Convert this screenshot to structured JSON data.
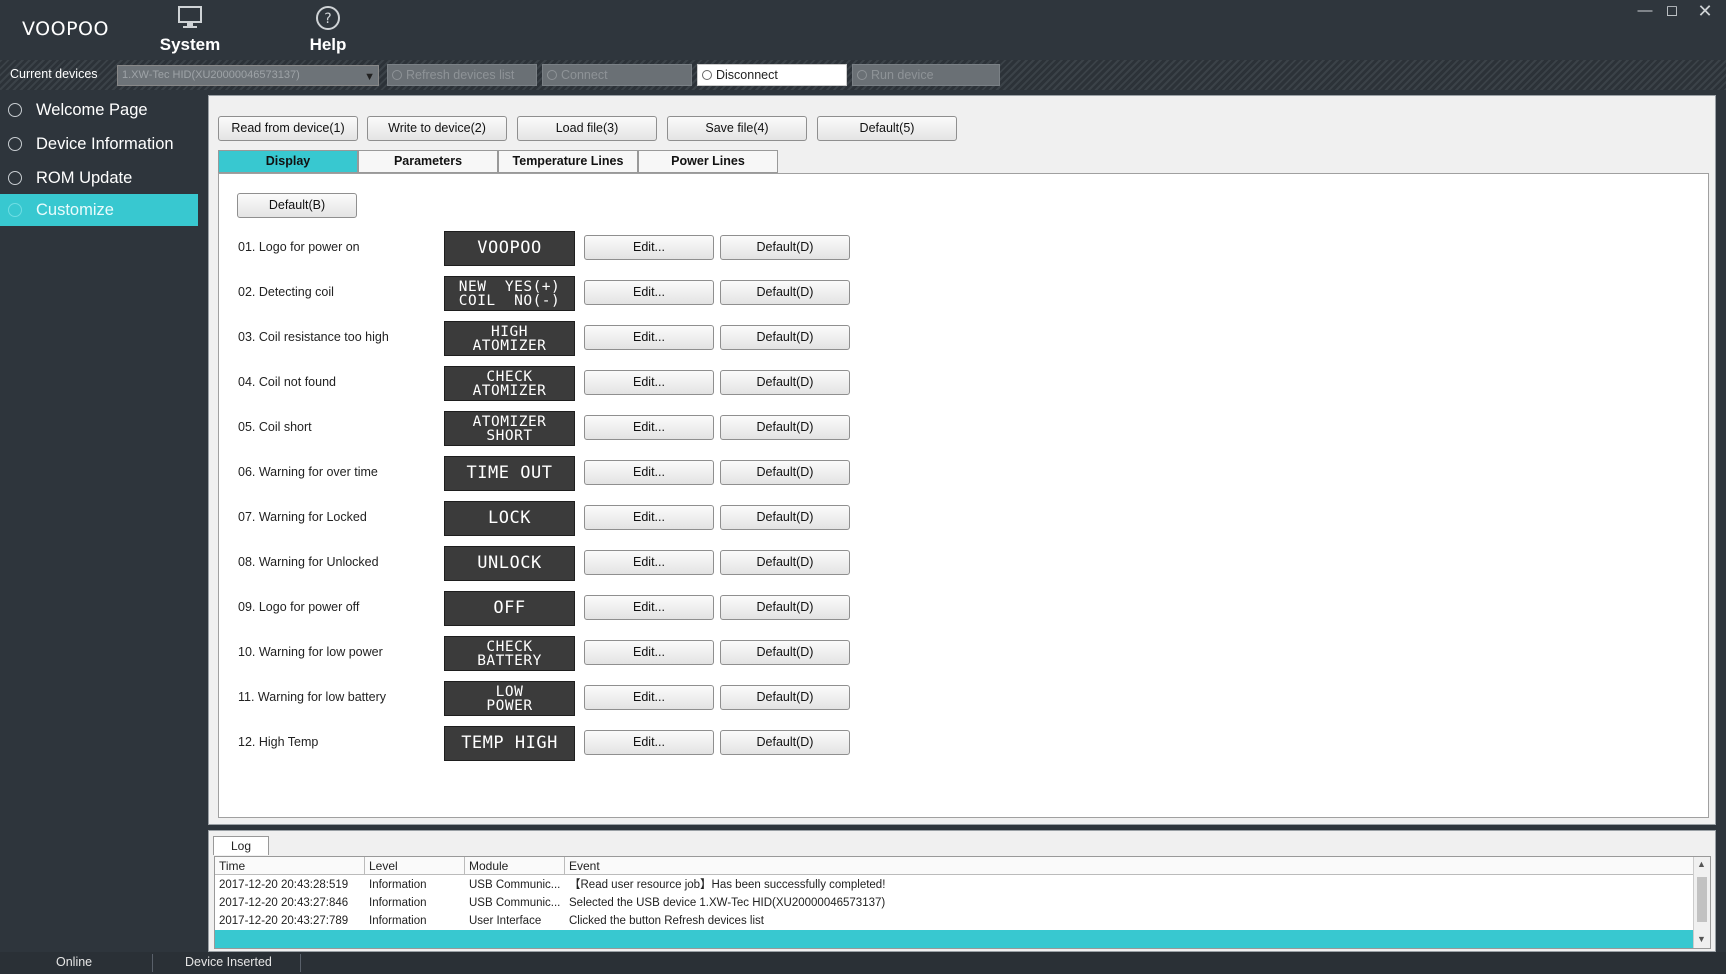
{
  "app": {
    "logo": "VOOPOO",
    "menu": [
      {
        "label": "System",
        "icon": "monitor-icon"
      },
      {
        "label": "Help",
        "icon": "help-icon"
      }
    ],
    "window_controls": [
      "minimize-icon",
      "maximize-icon",
      "close-icon"
    ]
  },
  "devbar": {
    "label": "Current devices",
    "selected_device": "1.XW-Tec HID(XU20000046573137)",
    "buttons": [
      {
        "label": "Refresh devices list",
        "enabled": false
      },
      {
        "label": "Connect",
        "enabled": false
      },
      {
        "label": "Disconnect",
        "enabled": true
      },
      {
        "label": "Run device",
        "enabled": false
      }
    ]
  },
  "sidebar": {
    "items": [
      {
        "label": "Welcome Page",
        "active": false
      },
      {
        "label": "Device Information",
        "active": false
      },
      {
        "label": "ROM Update",
        "active": false
      },
      {
        "label": "Customize",
        "active": true
      }
    ]
  },
  "toolbar": {
    "buttons": [
      "Read from device(1)",
      "Write to device(2)",
      "Load file(3)",
      "Save file(4)",
      "Default(5)"
    ]
  },
  "tabs": [
    {
      "label": "Display",
      "active": true
    },
    {
      "label": "Parameters",
      "active": false
    },
    {
      "label": "Temperature Lines",
      "active": false
    },
    {
      "label": "Power Lines",
      "active": false
    }
  ],
  "display": {
    "default_all_label": "Default(B)",
    "edit_label": "Edit...",
    "default_label": "Default(D)",
    "items": [
      {
        "label": "01. Logo for power on",
        "screen": [
          "VOOPOO"
        ]
      },
      {
        "label": "02. Detecting coil",
        "screen": [
          "NEW  YES(+)",
          "COIL  NO(-)"
        ]
      },
      {
        "label": "03. Coil resistance too high",
        "screen": [
          "HIGH",
          "ATOMIZER"
        ]
      },
      {
        "label": "04. Coil not found",
        "screen": [
          "CHECK",
          "ATOMIZER"
        ]
      },
      {
        "label": "05. Coil short",
        "screen": [
          "ATOMIZER",
          "SHORT"
        ]
      },
      {
        "label": "06. Warning for over time",
        "screen": [
          "TIME OUT"
        ]
      },
      {
        "label": "07. Warning for Locked",
        "screen": [
          "LOCK"
        ]
      },
      {
        "label": "08. Warning for Unlocked",
        "screen": [
          "UNLOCK"
        ]
      },
      {
        "label": "09. Logo for power off",
        "screen": [
          "OFF"
        ]
      },
      {
        "label": "10. Warning for low power",
        "screen": [
          "CHECK",
          "BATTERY"
        ]
      },
      {
        "label": "11. Warning for low battery",
        "screen": [
          "LOW",
          "POWER"
        ]
      },
      {
        "label": "12. High Temp",
        "screen": [
          "TEMP HIGH"
        ]
      }
    ]
  },
  "log": {
    "tab_label": "Log",
    "columns": [
      "Time",
      "Level",
      "Module",
      "Event"
    ],
    "rows": [
      [
        "2017-12-20 20:43:28:519",
        "Information",
        "USB Communic...",
        "【Read user resource job】Has been successfully completed!"
      ],
      [
        "2017-12-20 20:43:27:846",
        "Information",
        "USB Communic...",
        "Selected the USB device 1.XW-Tec HID(XU20000046573137)"
      ],
      [
        "2017-12-20 20:43:27:789",
        "Information",
        "User Interface",
        "Clicked the button Refresh devices list"
      ]
    ]
  },
  "status": {
    "online": "Online",
    "device": "Device Inserted"
  }
}
